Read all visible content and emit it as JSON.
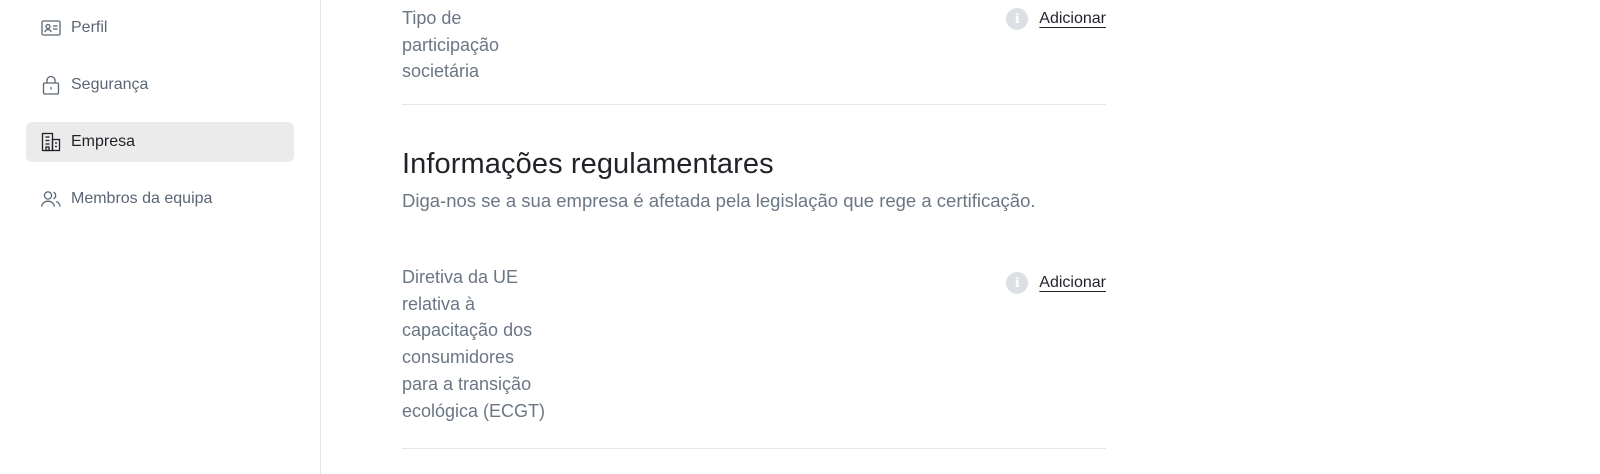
{
  "sidebar": {
    "items": [
      {
        "label": "Perfil",
        "icon": "profile-card-icon",
        "active": false
      },
      {
        "label": "Segurança",
        "icon": "lock-icon",
        "active": false
      },
      {
        "label": "Empresa",
        "icon": "building-icon",
        "active": true
      },
      {
        "label": "Membros da equipa",
        "icon": "team-members-icon",
        "active": false
      }
    ]
  },
  "main": {
    "fields": [
      {
        "label_lines": [
          "Tipo de",
          "participação",
          "societária"
        ],
        "action_label": "Adicionar",
        "info_icon": "info-icon"
      },
      {
        "label_lines": [
          "Diretiva da UE",
          "relativa à",
          "capacitação dos",
          "consumidores",
          "para a transição",
          "ecológica (ECGT)"
        ],
        "action_label": "Adicionar",
        "info_icon": "info-icon"
      }
    ],
    "regulatory_section": {
      "title": "Informações regulamentares",
      "subtitle": "Diga-nos se a sua empresa é afetada pela legislação que rege a certificação."
    }
  },
  "colors": {
    "active_nav_bg": "#ebebeb",
    "muted_text": "#6b7685",
    "primary_text": "#1f2328",
    "divider": "#e5e7ea",
    "info_icon_bg": "#dcdfe3"
  }
}
